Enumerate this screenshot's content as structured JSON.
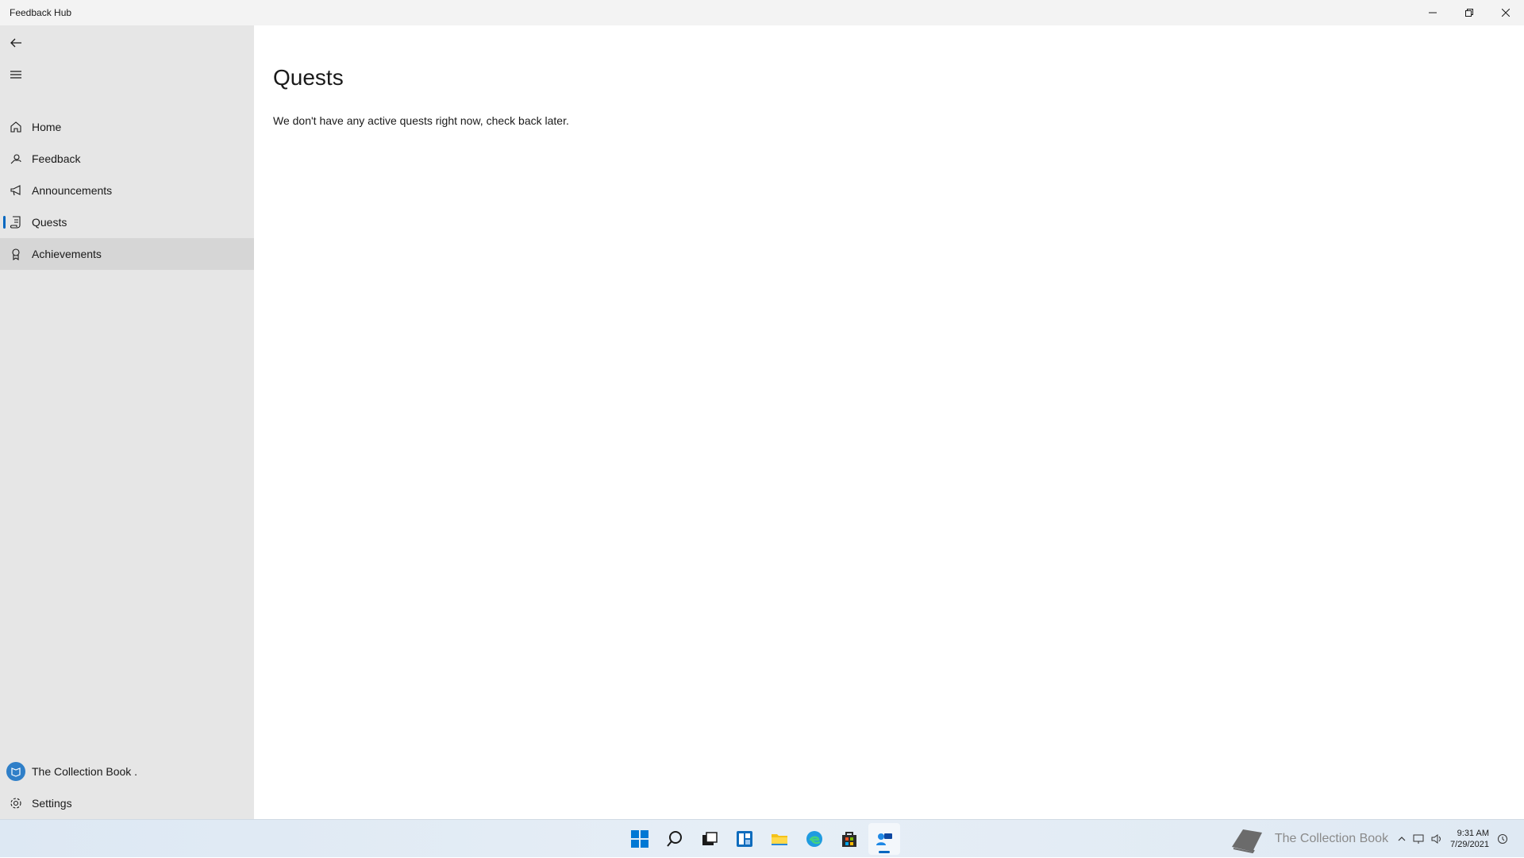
{
  "app": {
    "title": "Feedback Hub"
  },
  "window_controls": {
    "minimize": "─",
    "restore": "❐",
    "close": "✕"
  },
  "sidebar": {
    "items": [
      {
        "label": "Home",
        "icon": "home-icon"
      },
      {
        "label": "Feedback",
        "icon": "feedback-icon"
      },
      {
        "label": "Announcements",
        "icon": "megaphone-icon"
      },
      {
        "label": "Quests",
        "icon": "quest-scroll-icon",
        "selected": true
      },
      {
        "label": "Achievements",
        "icon": "badge-icon"
      }
    ],
    "account_label": "The Collection Book .",
    "settings_label": "Settings"
  },
  "main": {
    "title": "Quests",
    "message": "We don't have any active quests right now, check back later."
  },
  "taskbar": {
    "apps": [
      "windows-start-icon",
      "search-icon",
      "task-view-icon",
      "widgets-icon",
      "file-explorer-icon",
      "edge-icon",
      "store-icon",
      "feedback-hub-icon"
    ],
    "tray_watermark": "The Collection Book",
    "time": "9:31 AM",
    "date": "7/29/2021"
  },
  "colors": {
    "accent": "#0067c0",
    "sidebar_bg": "#e6e6e6",
    "titlebar_bg": "#f3f3f3"
  }
}
